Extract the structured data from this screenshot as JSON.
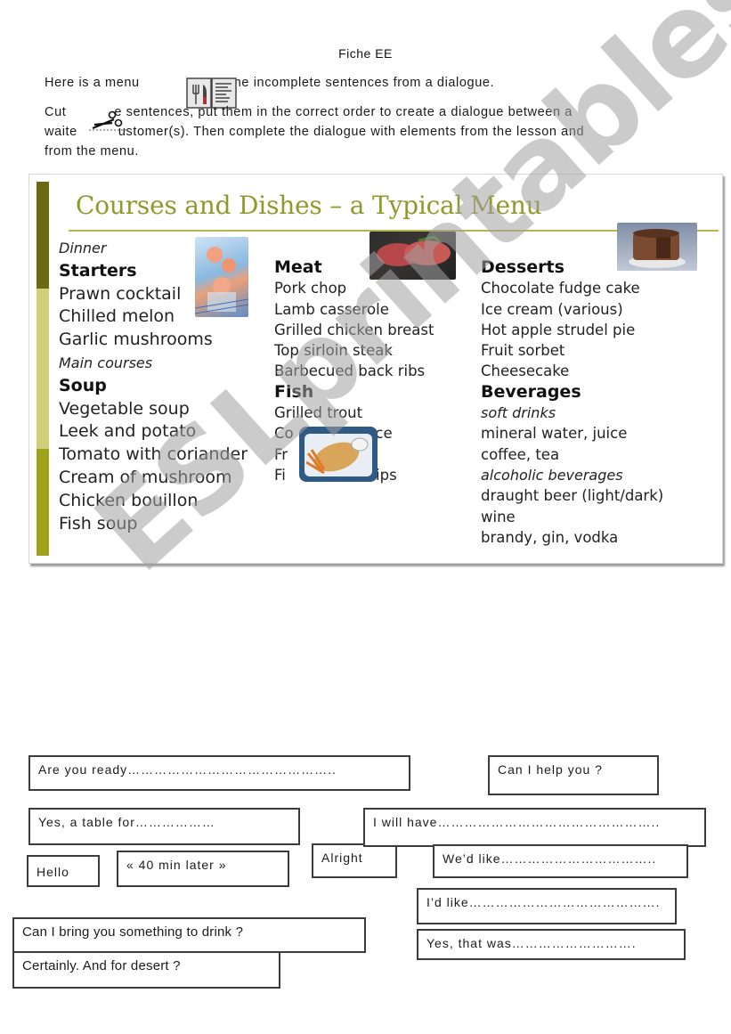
{
  "header": {
    "title": "Fiche EE",
    "instructions": {
      "line1_a": "Here is a menu",
      "line1_b": "me incomplete sentences from a dialogue.",
      "line2_a": "Cut",
      "line2_b": "e sentences, put them in the correct order to create a dialogue between a",
      "line3_a": "waite",
      "line3_b": "ustomer(s). Then complete the dialogue with elements from the lesson and",
      "line4": "from the menu."
    },
    "icons": [
      "menu-book-icon",
      "scissors-icon"
    ]
  },
  "menu": {
    "title": "Courses and Dishes – a Typical Menu",
    "colors": {
      "title": "#8f9a2a",
      "bar_top": "#6b6a12",
      "bar_mid": "#cfcf7a",
      "bar_bottom": "#a0a01a",
      "rule": "#b4b54e"
    },
    "columns": [
      {
        "lines": [
          {
            "text": "Dinner",
            "style": "italic"
          },
          {
            "text": "Starters",
            "style": "head"
          },
          {
            "text": "Prawn cocktail",
            "style": "item"
          },
          {
            "text": "Chilled melon",
            "style": "item"
          },
          {
            "text": "Garlic mushrooms",
            "style": "item"
          },
          {
            "text": "Main courses",
            "style": "italic"
          },
          {
            "text": "Soup",
            "style": "head"
          },
          {
            "text": "Vegetable soup",
            "style": "item"
          },
          {
            "text": "Leek and potato",
            "style": "item"
          },
          {
            "text": "Tomato with coriander",
            "style": "item"
          },
          {
            "text": "Cream of mushroom",
            "style": "item"
          },
          {
            "text": "Chicken bouillon",
            "style": "item"
          },
          {
            "text": "Fish soup",
            "style": "item"
          }
        ]
      },
      {
        "lines": [
          {
            "text": "Meat",
            "style": "head"
          },
          {
            "text": "Pork chop",
            "style": "item"
          },
          {
            "text": "Lamb casserole",
            "style": "item"
          },
          {
            "text": "Grilled chicken breast",
            "style": "item"
          },
          {
            "text": "Top sirloin steak",
            "style": "item"
          },
          {
            "text": "Barbecued back ribs",
            "style": "item"
          },
          {
            "text": "Fish",
            "style": "head"
          },
          {
            "text": "Grilled trout",
            "style": "item"
          },
          {
            "text": "Co         e sauce",
            "style": "item"
          },
          {
            "text": "Fr",
            "style": "item"
          },
          {
            "text": "Fi            n´chips",
            "style": "item"
          }
        ]
      },
      {
        "lines": [
          {
            "text": "Desserts",
            "style": "head"
          },
          {
            "text": "Chocolate fudge cake",
            "style": "item"
          },
          {
            "text": "Ice cream (various)",
            "style": "item"
          },
          {
            "text": "Hot apple strudel pie",
            "style": "item"
          },
          {
            "text": "Fruit sorbet",
            "style": "item"
          },
          {
            "text": "Cheesecake",
            "style": "item"
          },
          {
            "text": "Beverages",
            "style": "head"
          },
          {
            "text": "soft drinks",
            "style": "italic"
          },
          {
            "text": "mineral water, juice",
            "style": "item"
          },
          {
            "text": "coffee, tea",
            "style": "item"
          },
          {
            "text": "alcoholic beverages",
            "style": "italic"
          },
          {
            "text": "draught beer (light/dark)",
            "style": "item"
          },
          {
            "text": "wine",
            "style": "item"
          },
          {
            "text": "brandy, gin, vodka",
            "style": "item"
          }
        ]
      }
    ],
    "photos": [
      "prawn-cocktail-photo",
      "steak-photo",
      "chocolate-cake-photo",
      "fish-and-chips-photo"
    ]
  },
  "watermark": "ESLprintables.com",
  "strips": [
    "Are you ready………………………………………..",
    "Can I help you ?",
    "Yes, a table for………………",
    "I will have…………………………………………..",
    "Hello",
    "« 40 min later »",
    "Alright",
    "We’d like……………………………..",
    "I’d like…………………………………….",
    "Can I bring you something to drink ?",
    "Certainly. And for desert ?",
    "Yes, that was………………………."
  ]
}
